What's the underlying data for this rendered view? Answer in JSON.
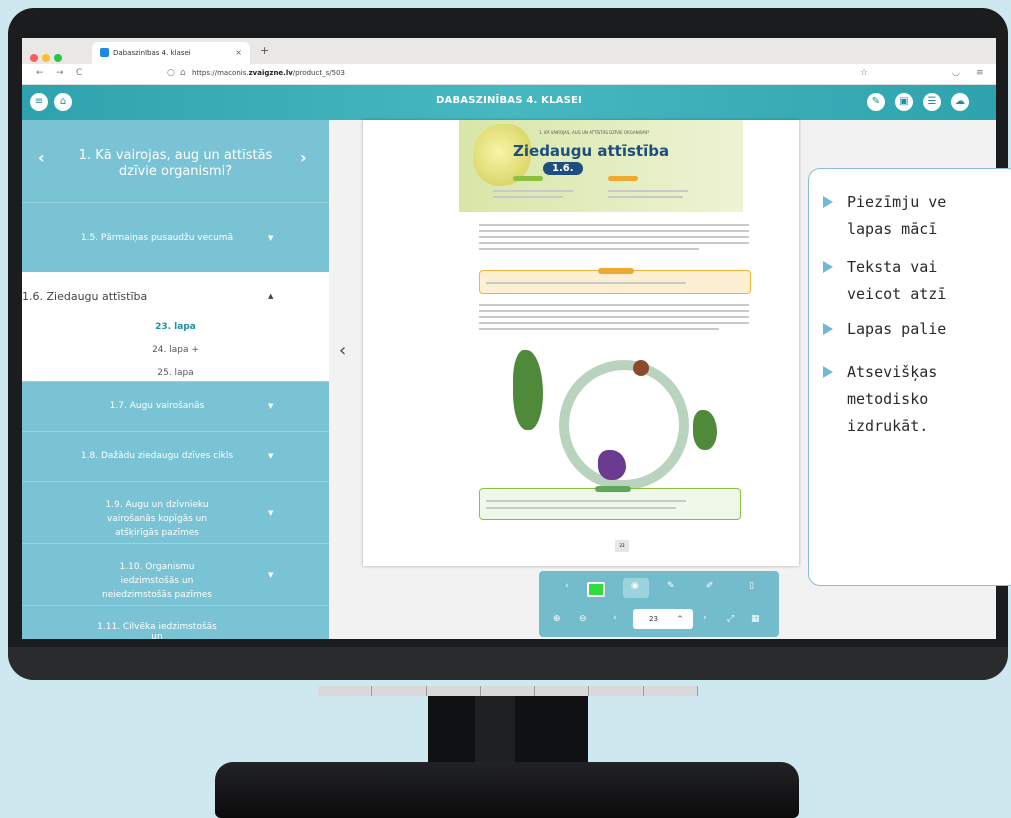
{
  "browser": {
    "tab_title": "Dabaszinības 4. klasei",
    "tab_close": "×",
    "new_tab": "+",
    "url_prefix": "https://maconis.",
    "url_domain": "zvaigzne.lv",
    "url_path": "/product_s/503",
    "colors": {
      "close": "#ff5f57",
      "minimize": "#febc2e",
      "zoom": "#28c840"
    }
  },
  "app": {
    "title": "DABASZINĪBAS 4. KLASEI",
    "accent": "#2fa3ad",
    "left_icons": [
      "menu-icon",
      "home-icon"
    ],
    "right_icons": [
      "notes-icon",
      "edit-page-icon",
      "list-icon",
      "cloud-icon"
    ]
  },
  "sidebar": {
    "chapter": "1. Kā vairojas, aug un attīstās dzīvie organismi?",
    "sections": [
      {
        "label": "1.5. Pārmaiņas pusaudžu vecumā"
      },
      {
        "label": "1.6. Ziedaugu attīstība",
        "pages": [
          "23. lapa",
          "24. lapa +",
          "25. lapa"
        ],
        "current": "23. lapa"
      },
      {
        "label": "1.7. Augu vairošanās"
      },
      {
        "label": "1.8. Dažādu ziedaugu dzīves cikls"
      },
      {
        "label": "1.9. Augu un dzīvnieku vairošanās kopīgās un atšķirīgās pazīmes"
      },
      {
        "label": "1.10. Organismu iedzimstošās un neiedzimstošās pazīmes"
      },
      {
        "label": "1.11. Cilvēka iedzimstošās un"
      }
    ]
  },
  "book_page": {
    "kicker": "1. KĀ VAIROJAS, AUG UN ATTĪSTĀS DZĪVIE ORGANISMI?",
    "title": "Ziedaugu attīstība",
    "number": "1.6.",
    "footer_number": "23"
  },
  "toolbar": {
    "page_value": "23",
    "pen_color": "#2fde3c"
  },
  "callout": {
    "bullets": [
      [
        "Piezīmju ve",
        "lapas mācī"
      ],
      [
        "Teksta vai",
        "veicot atzī"
      ],
      [
        "Lapas palie"
      ],
      [
        "Atsevišķas",
        "metodisko",
        "izdrukāt."
      ]
    ]
  }
}
